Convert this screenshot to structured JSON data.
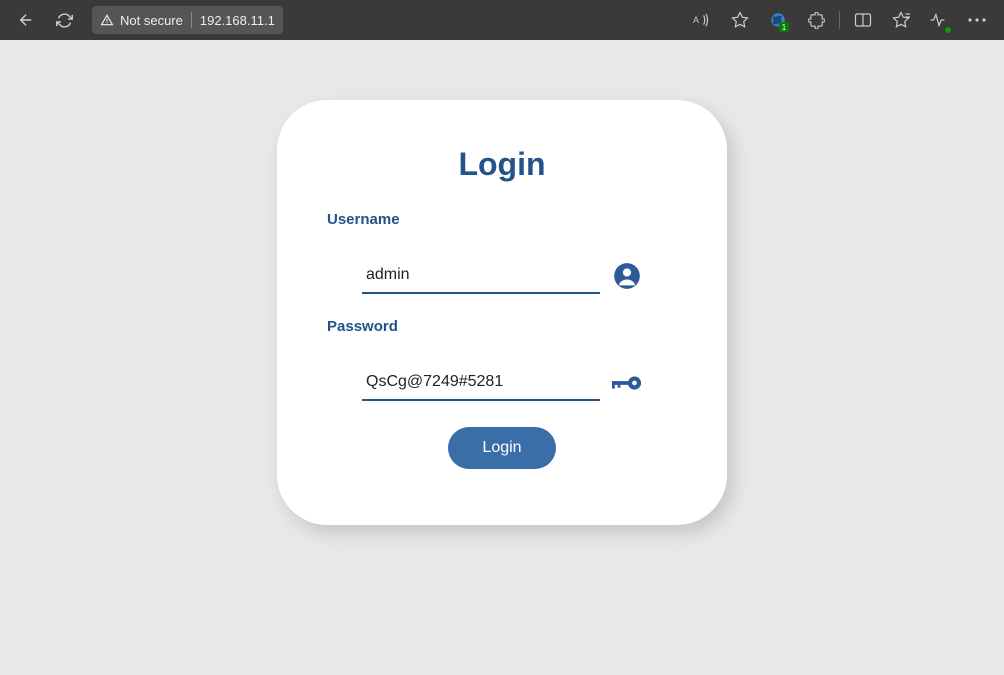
{
  "browser": {
    "security_label": "Not secure",
    "url": "192.168.11.1",
    "extension_badge": "1"
  },
  "login": {
    "title": "Login",
    "username_label": "Username",
    "username_value": "admin",
    "password_label": "Password",
    "password_value": "QsCg@7249#5281",
    "button_label": "Login"
  }
}
